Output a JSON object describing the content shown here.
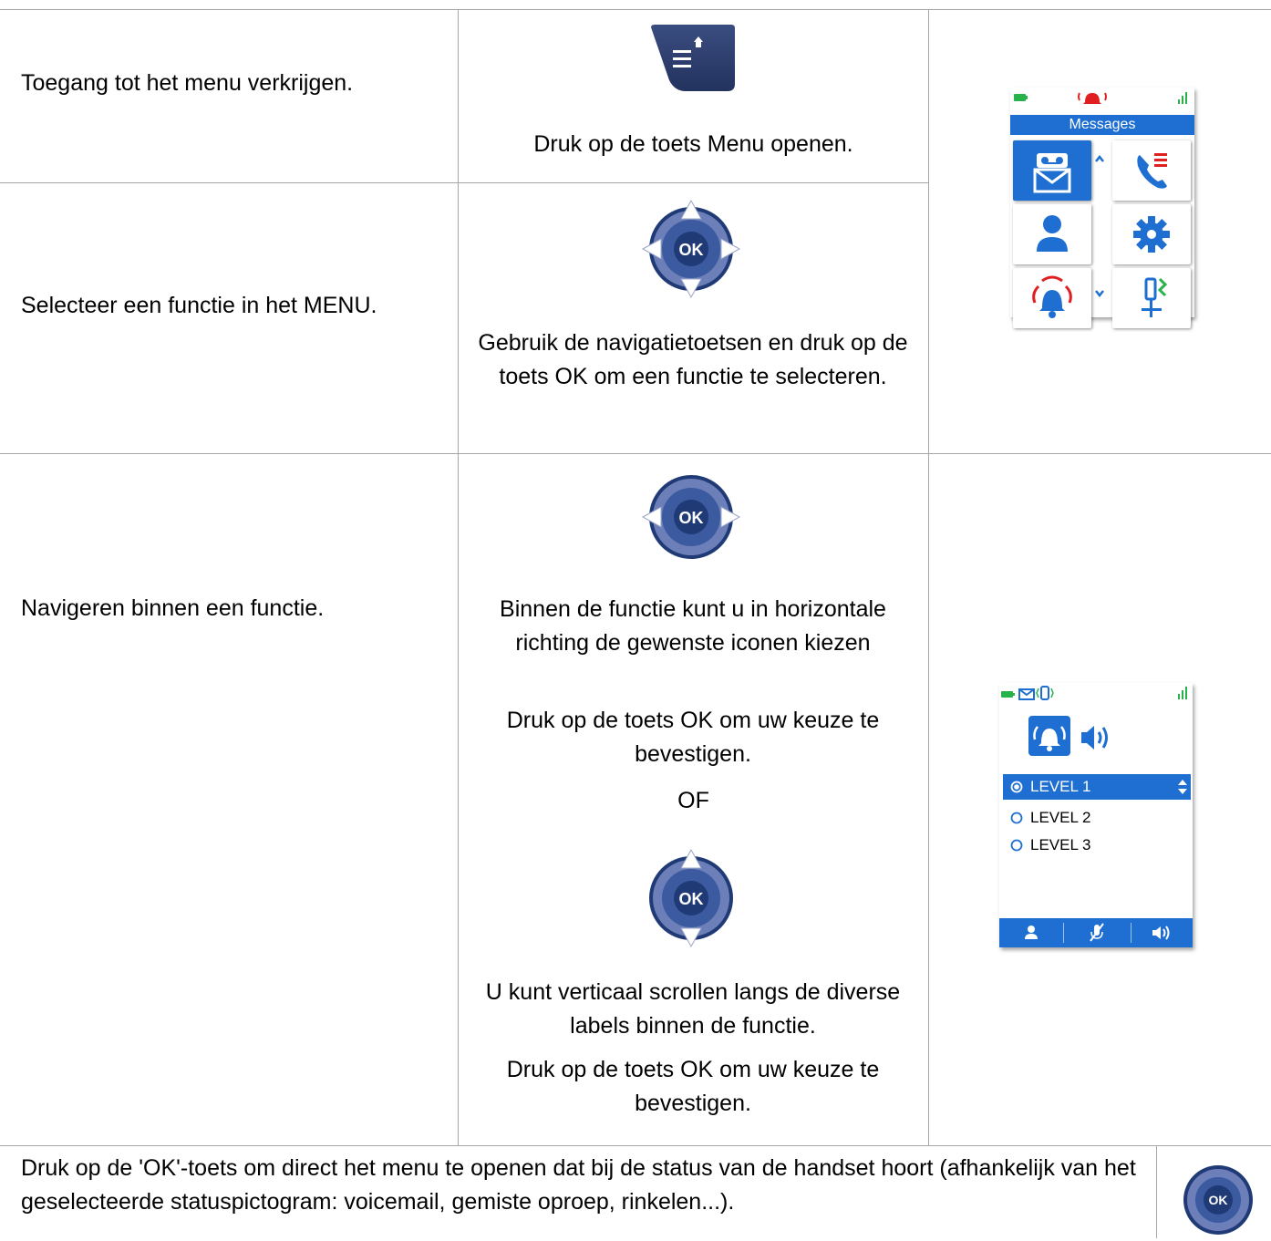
{
  "rows": [
    {
      "description": "Toegang tot het menu verkrijgen.",
      "instruction": "Druk op de toets Menu openen."
    },
    {
      "description": "Selecteer een functie in het MENU.",
      "instruction": "Gebruik de navigatietoetsen en druk op de toets OK om een functie te selecteren."
    },
    {
      "description": "Navigeren binnen een functie.",
      "instruction_horizontal": "Binnen de functie kunt u in horizontale richting de gewenste iconen kiezen",
      "confirm_1": "Druk op de toets OK om uw keuze te bevestigen.",
      "or_label": "OF",
      "instruction_vertical": "U kunt verticaal scrollen langs de diverse labels binnen de functie.",
      "confirm_2": "Druk op de toets OK om uw keuze te bevestigen."
    }
  ],
  "footer": {
    "text": "Druk op de 'OK'-toets om direct het menu te openen dat bij de status van de handset hoort (afhankelijk van het geselecteerde statuspictogram: voicemail, gemiste oproep, rinkelen...)."
  },
  "keys": {
    "ok_label": "OK"
  },
  "menu_screen": {
    "title": "Messages",
    "icons": [
      "voicemail-icon",
      "call-log-icon",
      "contacts-icon",
      "settings-icon",
      "ringing-icon",
      "accessories-icon"
    ]
  },
  "level_screen": {
    "options": [
      "LEVEL 1",
      "LEVEL 2",
      "LEVEL 3"
    ],
    "selected": "LEVEL 1"
  },
  "colors": {
    "screen_blue": "#1e6fd1",
    "key_navy": "#1f3a75",
    "key_ring": "#6d7fb8",
    "battery_green": "#27b34a",
    "alarm_red": "#e02020"
  }
}
